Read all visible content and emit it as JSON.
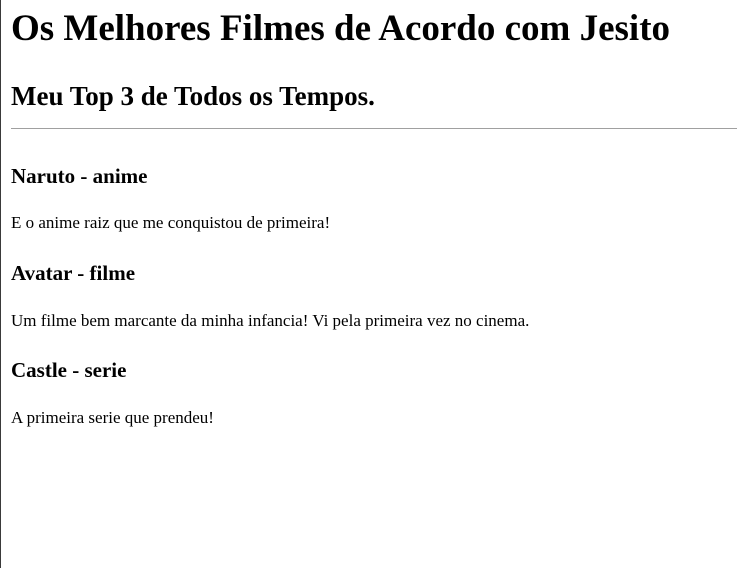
{
  "page": {
    "title": "Os Melhores Filmes de Acordo com Jesito",
    "subtitle": "Meu Top 3 de Todos os Tempos."
  },
  "entries": [
    {
      "title": "Naruto - anime",
      "description": "E o anime raiz que me conquistou de primeira!"
    },
    {
      "title": "Avatar - filme",
      "description": "Um filme bem marcante da minha infancia! Vi pela primeira vez no cinema."
    },
    {
      "title": "Castle - serie",
      "description": "A primeira serie que prendeu!"
    }
  ]
}
